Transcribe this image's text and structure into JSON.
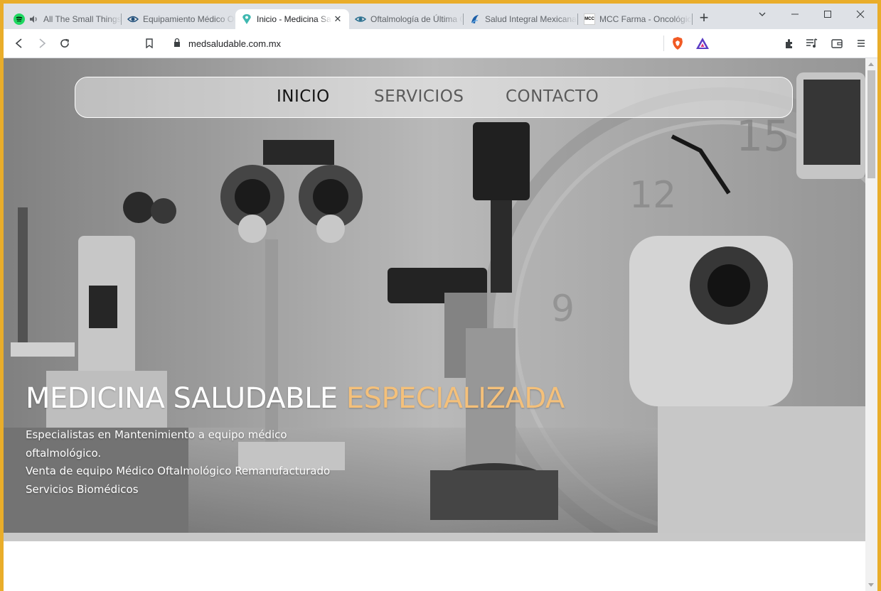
{
  "browser": {
    "tabs": [
      {
        "title": "All The Small Things",
        "favicon": "spotify-icon",
        "audio": true
      },
      {
        "title": "Equipamiento Médico Oftalmológico",
        "favicon": "eye-icon"
      },
      {
        "title": "Inicio - Medicina Saludable",
        "favicon": "medicina-logo-icon",
        "active": true
      },
      {
        "title": "Oftalmología de Última Generación",
        "favicon": "eye-icon"
      },
      {
        "title": "Salud Integral Mexicana",
        "favicon": "salud-logo-icon"
      },
      {
        "title": "MCC Farma - Oncológicos",
        "favicon": "mcc-logo-icon",
        "favicon_text": "MCC"
      }
    ],
    "url": "medsaludable.com.mx"
  },
  "site": {
    "nav": {
      "inicio": "INICIO",
      "servicios": "SERVICIOS",
      "contacto": "CONTACTO"
    },
    "hero": {
      "title_main": "MEDICINA SALUDABLE",
      "title_accent": "ESPECIALIZADA",
      "lines": [
        "Especialistas en Mantenimiento a equipo médico",
        "oftalmológico.",
        "Venta de equipo Médico Oftalmológico Remanufacturado",
        "Servicios Biomédicos"
      ]
    }
  },
  "colors": {
    "accent": "#f4c07a",
    "desktop": "#e9ad2a"
  }
}
